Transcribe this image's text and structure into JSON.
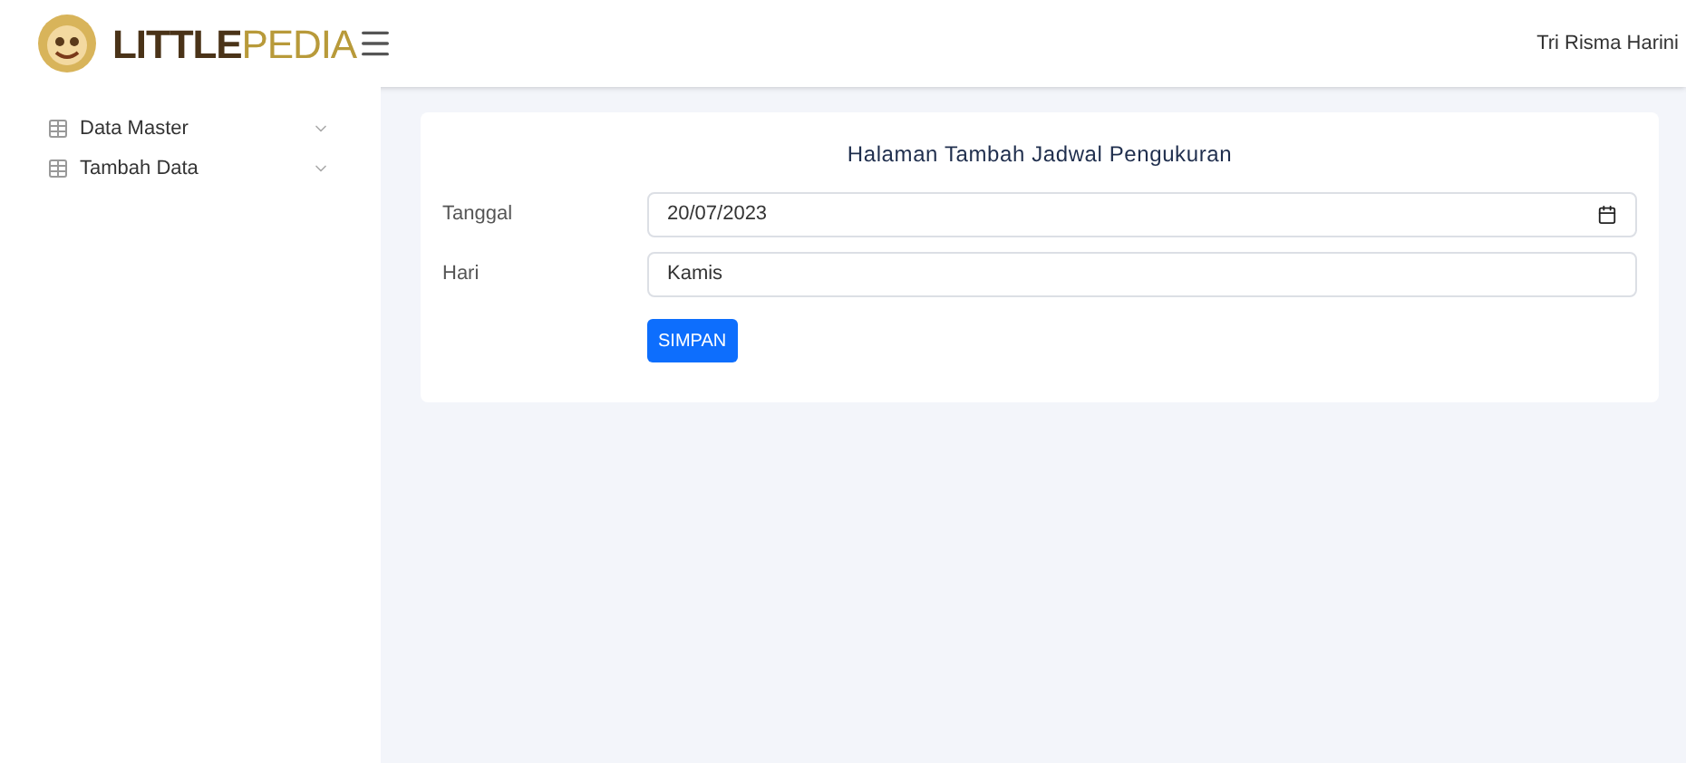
{
  "header": {
    "logo_parts": [
      "LITTLE",
      "PEDIA"
    ],
    "user": "Tri Risma Harini"
  },
  "sidebar": {
    "items": [
      {
        "label": "Data Master",
        "expanded": false
      },
      {
        "label": "Tambah Data",
        "expanded": false
      }
    ]
  },
  "form": {
    "title": "Halaman Tambah Jadwal Pengukuran",
    "fields": [
      {
        "label": "Tanggal",
        "kind": "date",
        "value": "20/07/2023"
      },
      {
        "label": "Hari",
        "kind": "text",
        "value": "Kamis"
      }
    ],
    "submit": "SIMPAN"
  }
}
